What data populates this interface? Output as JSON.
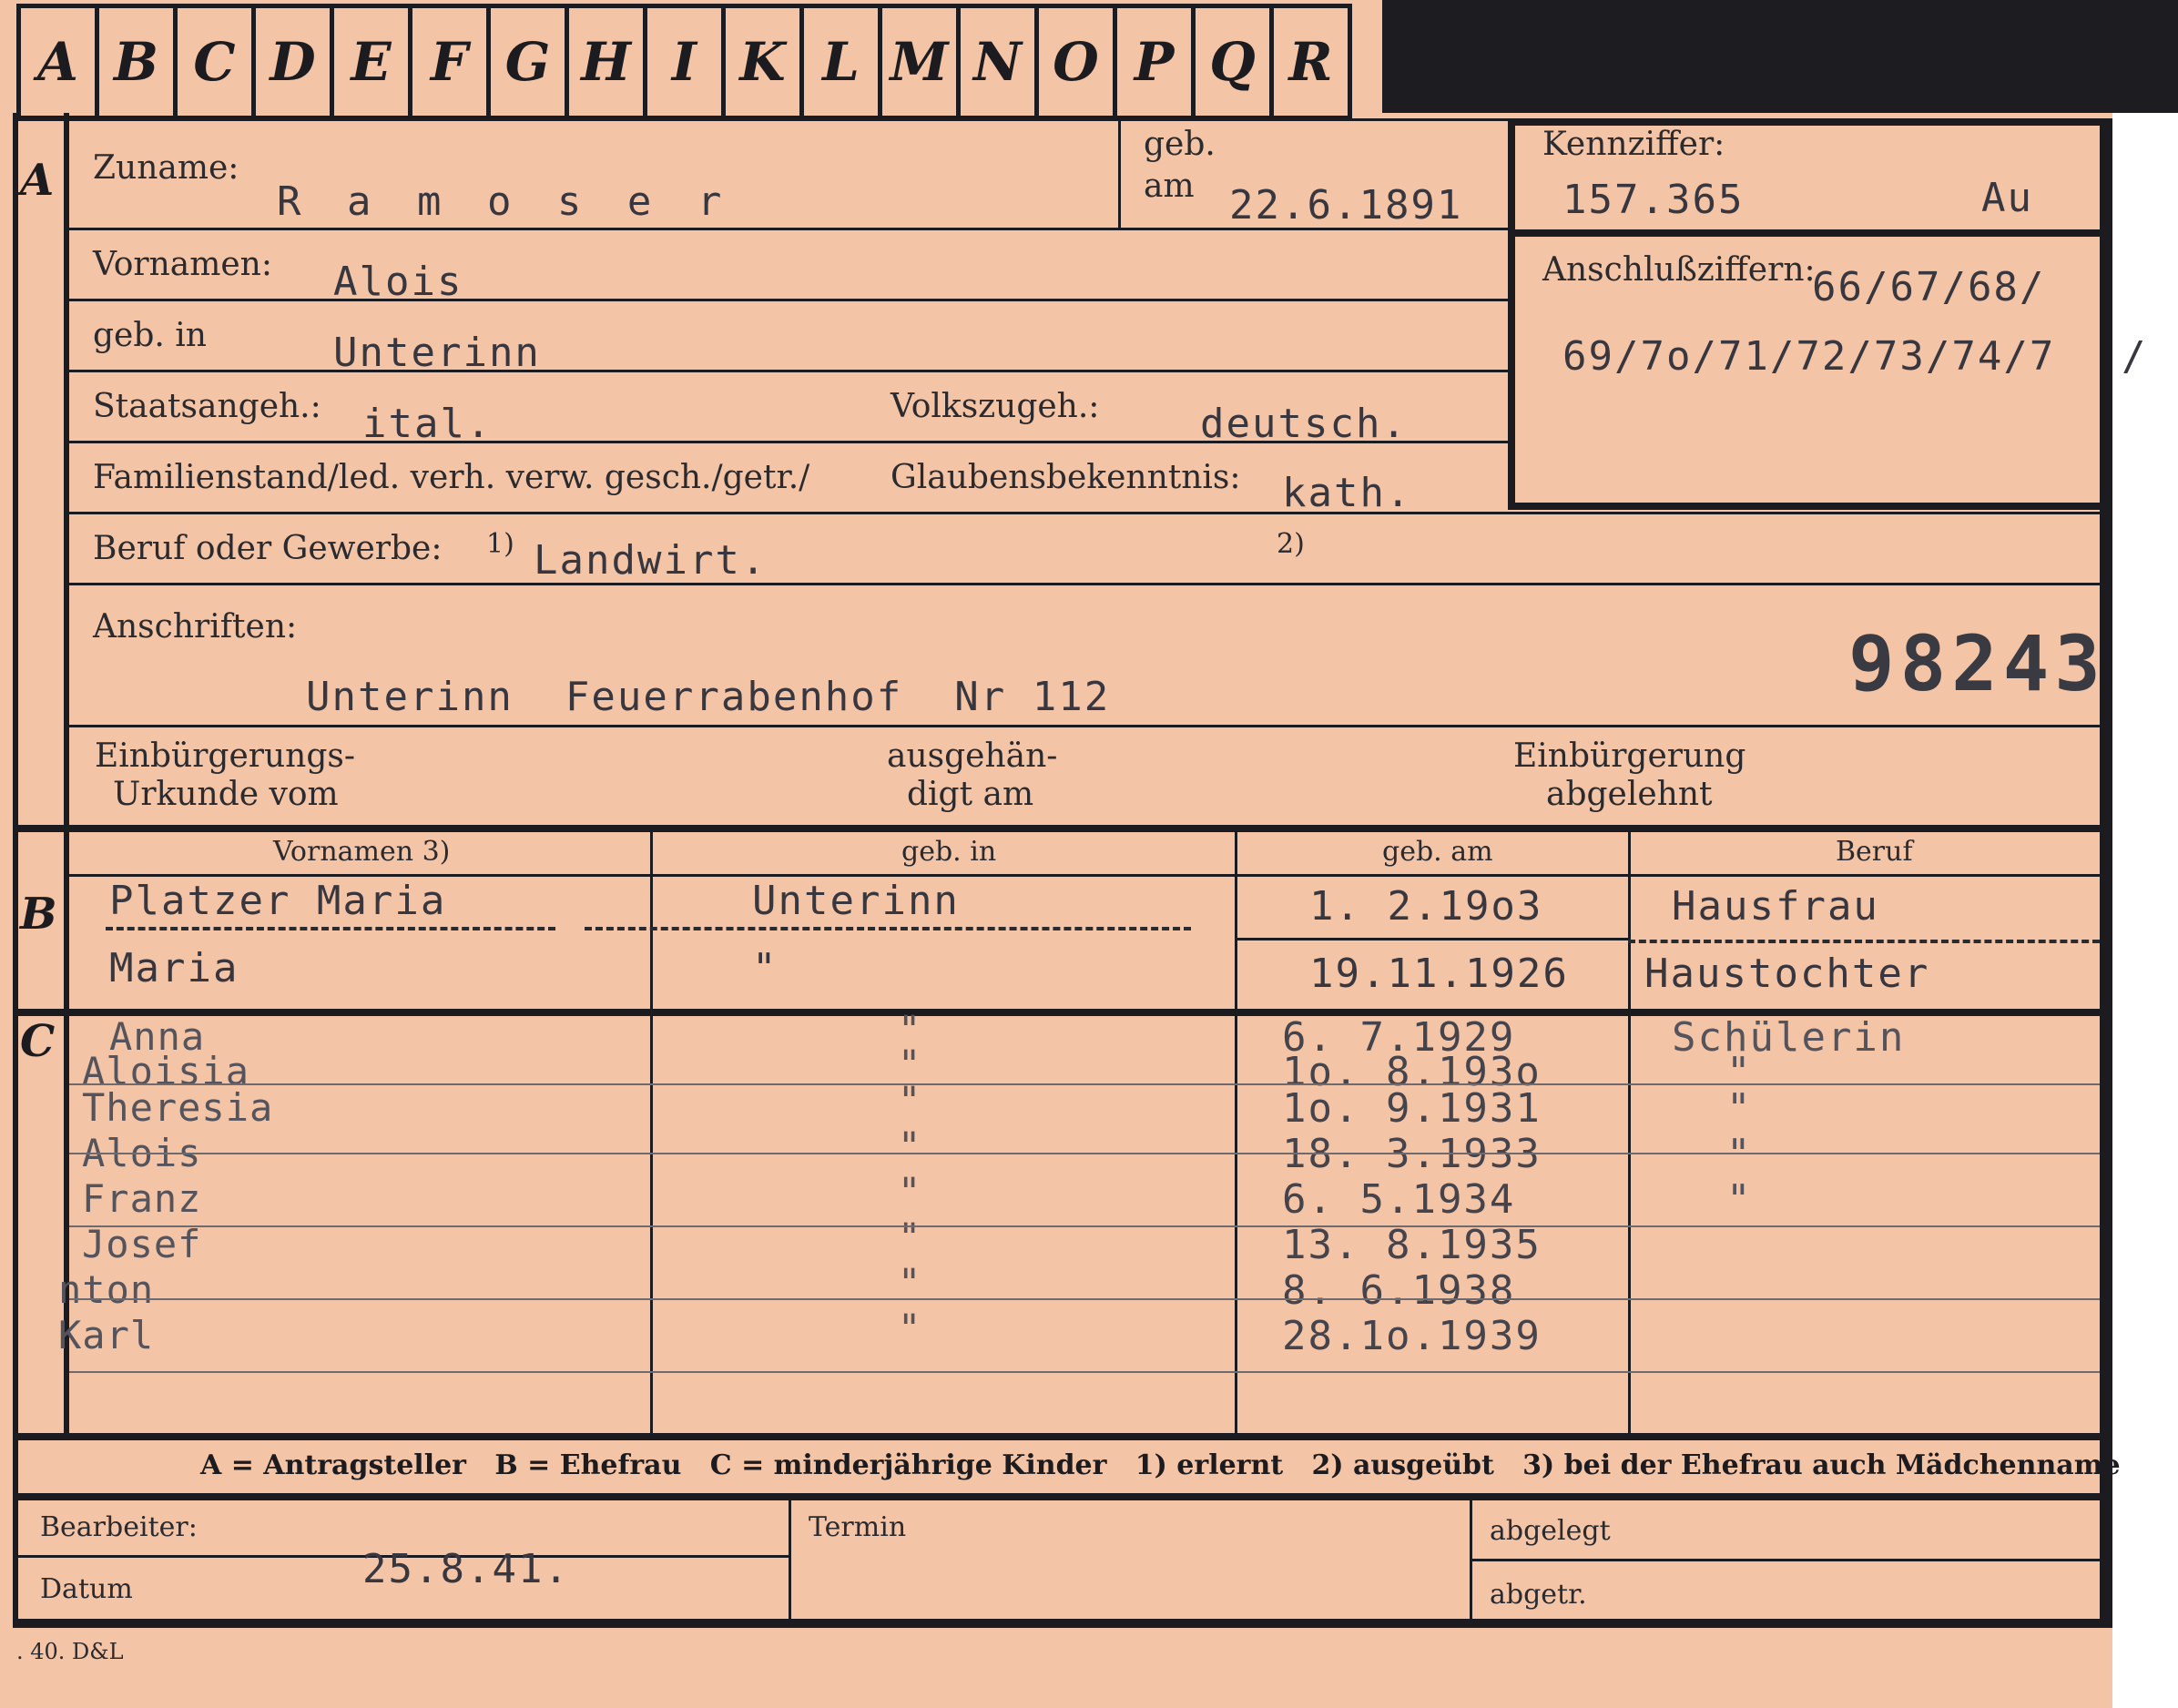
{
  "tabs": [
    "A",
    "B",
    "C",
    "D",
    "E",
    "F",
    "G",
    "H",
    "I",
    "K",
    "L",
    "M",
    "N",
    "O",
    "P",
    "Q",
    "R"
  ],
  "section_a": {
    "letter": "A",
    "zuname_label": "Zuname:",
    "zuname_value": "R a m o s e r",
    "geb_label_1": "geb.",
    "geb_label_2": "am",
    "geb_value": "22.6.1891",
    "kennziffer_label": "Kennziffer:",
    "kennziffer_value": "157.365",
    "kennziffer_suffix": "Au",
    "anschluss_label": "Anschlußziffern:",
    "anschluss_line1": "66/67/68/",
    "anschluss_line2": "69/7o/71/72/73/74/7",
    "anschluss_tail": "/",
    "vornamen_label": "Vornamen:",
    "vornamen_value": "Alois",
    "gebin_label": "geb. in",
    "gebin_value": "Unterinn",
    "staats_label": "Staatsangeh.:",
    "staats_value": "ital.",
    "volks_label": "Volkszugeh.:",
    "volks_value": "deutsch.",
    "familien_label": "Familienstand/led. verh. verw. gesch./getr./",
    "glaubens_label": "Glaubensbekenntnis:",
    "glaubens_value": "kath.",
    "beruf_label": "Beruf oder Gewerbe:",
    "beruf_note1": "1)",
    "beruf_value": "Landwirt.",
    "beruf_note2": "2)",
    "anschriften_label": "Anschriften:",
    "anschrift_value": "Unterinn  Feuerrabenhof  Nr 112",
    "stamp_number": "98243",
    "einb_urkunde_1": "Einbürgerungs-",
    "einb_urkunde_2": "Urkunde vom",
    "ausgeh_1": "ausgehän-",
    "ausgeh_2": "digt am",
    "einb_abgelehnt_1": "Einbürgerung",
    "einb_abgelehnt_2": "abgelehnt"
  },
  "table_header": {
    "col1": "Vornamen 3)",
    "col2": "geb. in",
    "col3": "geb. am",
    "col4": "Beruf"
  },
  "section_b": {
    "letter": "B",
    "rows": [
      {
        "name": "Platzer Maria",
        "place": "Unterinn",
        "date": "1. 2.19o3",
        "job": "Hausfrau"
      },
      {
        "name": "Maria",
        "place": "\"",
        "date": "19.11.1926",
        "job": "Haustochter"
      }
    ]
  },
  "section_c": {
    "letter": "C",
    "rows": [
      {
        "name": "Anna",
        "place": "\"",
        "date": "6. 7.1929",
        "job": "Schülerin"
      },
      {
        "name": "Aloisia",
        "place": "\"",
        "date": "1o. 8.193o",
        "job": "\""
      },
      {
        "name": "Theresia",
        "place": "\"",
        "date": "1o. 9.1931",
        "job": "\""
      },
      {
        "name": "Alois",
        "place": "\"",
        "date": "18. 3.1933",
        "job": "\""
      },
      {
        "name": "Franz",
        "place": "\"",
        "date": "6. 5.1934",
        "job": "\""
      },
      {
        "name": "Josef",
        "place": "\"",
        "date": "13. 8.1935",
        "job": ""
      },
      {
        "name": "nton",
        "place": "\"",
        "date": "8. 6.1938",
        "job": ""
      },
      {
        "name": "Karl",
        "place": "\"",
        "date": "28.1o.1939",
        "job": ""
      }
    ]
  },
  "legend": "A = Antragsteller   B = Ehefrau   C = minderjährige Kinder   1) erlernt   2) ausgeübt   3) bei der Ehefrau auch Mädchenname",
  "footer": {
    "bearbeiter_label": "Bearbeiter:",
    "datum_label": "Datum",
    "datum_value": "25.8.41.",
    "termin_label": "Termin",
    "abgelegt_label": "abgelegt",
    "abgetr_label": "abgetr.",
    "printer_mark": ". 40. D&L"
  }
}
